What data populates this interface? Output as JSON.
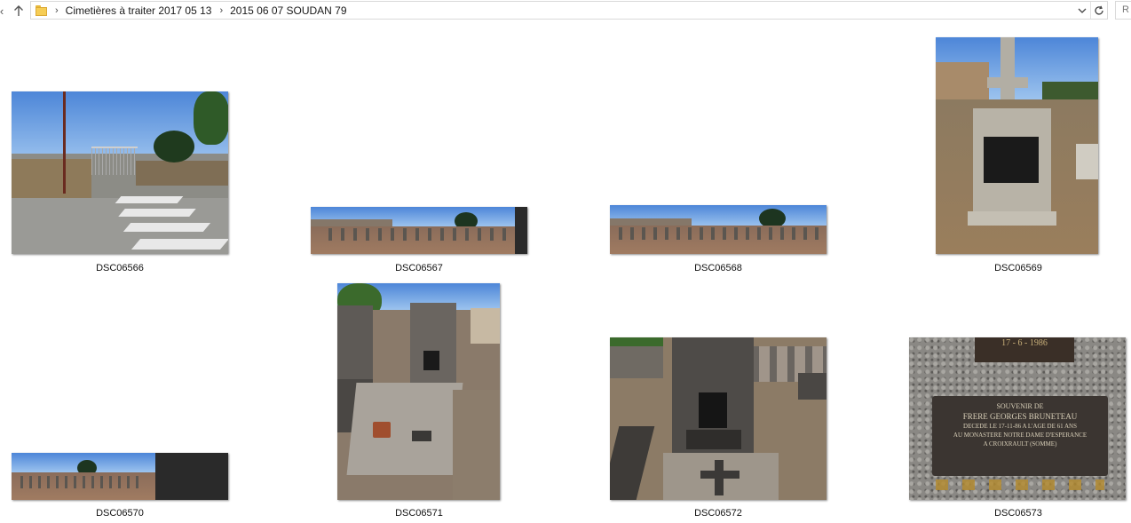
{
  "address_bar": {
    "breadcrumbs": [
      "Cimetières à traiter 2017 05 13",
      "2015 06 07 SOUDAN 79"
    ],
    "search_placeholder": "R"
  },
  "icons": {
    "back": "back-arrow-icon",
    "up": "up-arrow-icon",
    "folder": "folder-icon",
    "dropdown": "chevron-down-icon",
    "refresh": "refresh-icon"
  },
  "files": [
    {
      "name": "DSC06566"
    },
    {
      "name": "DSC06567"
    },
    {
      "name": "DSC06568"
    },
    {
      "name": "DSC06569"
    },
    {
      "name": "DSC06570"
    },
    {
      "name": "DSC06571"
    },
    {
      "name": "DSC06572"
    },
    {
      "name": "DSC06573"
    }
  ],
  "plaque_texts": {
    "date": "17 - 6 - 1986",
    "lines": [
      "SOUVENIR DE",
      "FRERE GEORGES BRUNETEAU",
      "DECEDE LE 17-11-86 A L'AGE DE 61 ANS",
      "AU MONASTERE NOTRE DAME D'ESPERANCE",
      "A CROIXRAULT (SOMME)"
    ]
  }
}
